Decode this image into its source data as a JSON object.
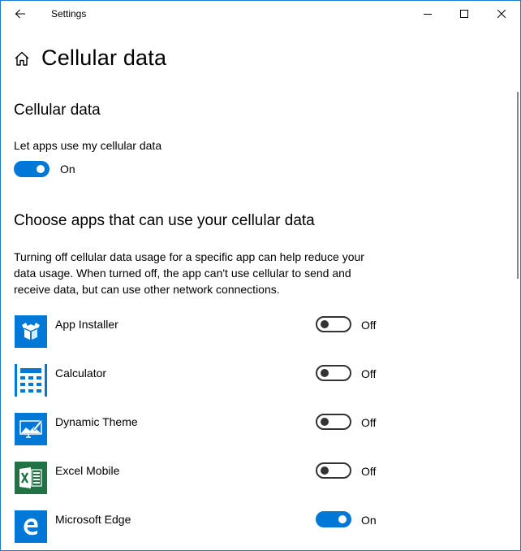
{
  "window": {
    "title": "Settings",
    "controls": {
      "minimize": "minimize-icon",
      "maximize": "maximize-icon",
      "close": "close-icon"
    },
    "border_color": "#1a7ad4"
  },
  "header": {
    "page_title": "Cellular data",
    "home_icon": "home-icon",
    "back_icon": "back-arrow-icon"
  },
  "cellular_section": {
    "title": "Cellular data",
    "toggle_label": "Let apps use my cellular data",
    "toggle_state": "On",
    "toggle_on": true
  },
  "apps_section": {
    "title": "Choose apps that can use your cellular data",
    "description": "Turning off cellular data usage for a specific app can help reduce your data usage. When turned off, the app can't use cellular to send and receive data, but can use other network connections.",
    "apps": [
      {
        "name": "App Installer",
        "icon": "app-installer-icon",
        "state": "Off",
        "on": false,
        "icon_color": "#0078d7"
      },
      {
        "name": "Calculator",
        "icon": "calculator-icon",
        "state": "Off",
        "on": false,
        "icon_color": "#0078d7"
      },
      {
        "name": "Dynamic Theme",
        "icon": "dynamic-theme-icon",
        "state": "Off",
        "on": false,
        "icon_color": "#0078d7"
      },
      {
        "name": "Excel Mobile",
        "icon": "excel-icon",
        "state": "Off",
        "on": false,
        "icon_color": "#217346"
      },
      {
        "name": "Microsoft Edge",
        "icon": "edge-icon",
        "state": "On",
        "on": true,
        "icon_color": "#0078d7"
      }
    ]
  },
  "colors": {
    "accent": "#0078d7",
    "toggle_off": "#333333",
    "scrollbar": "#858585"
  }
}
